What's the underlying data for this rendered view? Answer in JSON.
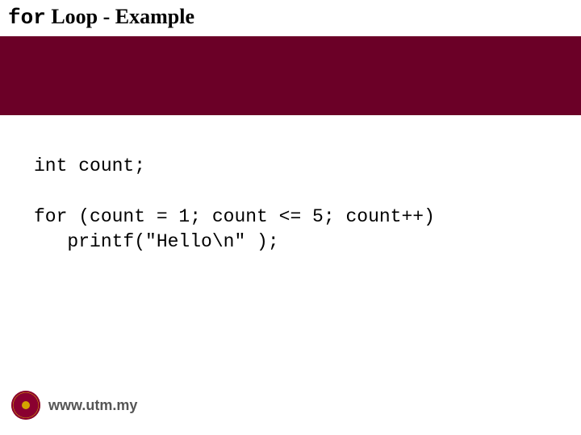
{
  "title": {
    "mono": "for",
    "rest": " Loop - Example"
  },
  "code": {
    "line1": "int count;",
    "line2": "for (count = 1; count <= 5; count++)",
    "line3": "   printf(\"Hello\\n\" );"
  },
  "footer": {
    "url": "www.utm.my"
  }
}
